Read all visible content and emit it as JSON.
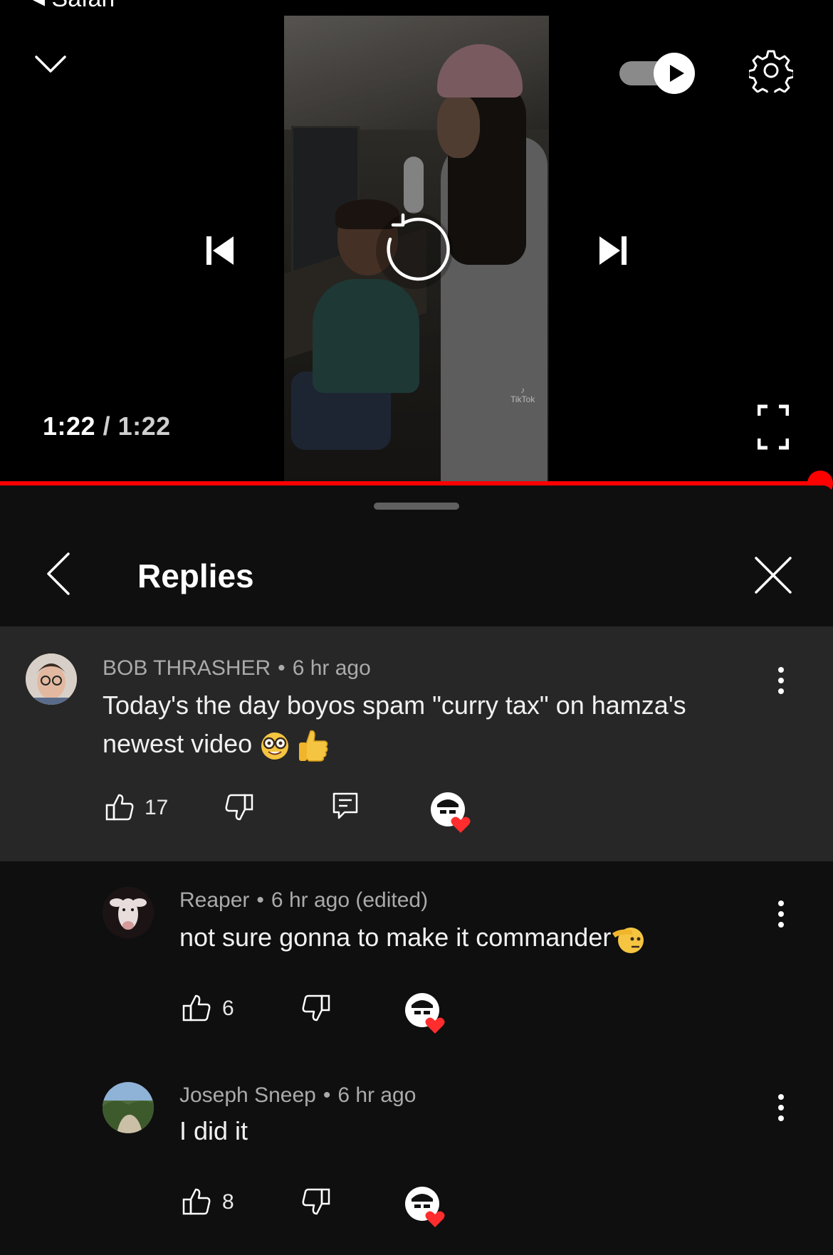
{
  "status": {
    "back_app": "◂ Safari"
  },
  "player": {
    "current_time": "1:22",
    "separator": "/",
    "duration": "1:22",
    "progress": 1.0,
    "watermark": "TikTok"
  },
  "sheet": {
    "title": "Replies"
  },
  "comments": [
    {
      "author": "BOB THRASHER",
      "time": "6 hr ago",
      "text": "Today's the day boyos spam \"curry tax\" on hamza's newest video",
      "emojis": [
        "nerd-face-emoji",
        "thumbs-up-emoji"
      ],
      "likes": "17"
    },
    {
      "author": "Reaper",
      "time": "6 hr ago (edited)",
      "text": "not sure gonna to make it commander",
      "emojis": [
        "saluting-face-emoji"
      ],
      "likes": "6"
    },
    {
      "author": "Joseph Sneep",
      "time": "6 hr ago",
      "text": "I did it",
      "emojis": [],
      "likes": "8"
    }
  ],
  "colors": {
    "accent": "#ff0000",
    "background": "#0f0f0f",
    "highlight": "#272727",
    "heart": "#ff2d2d"
  }
}
